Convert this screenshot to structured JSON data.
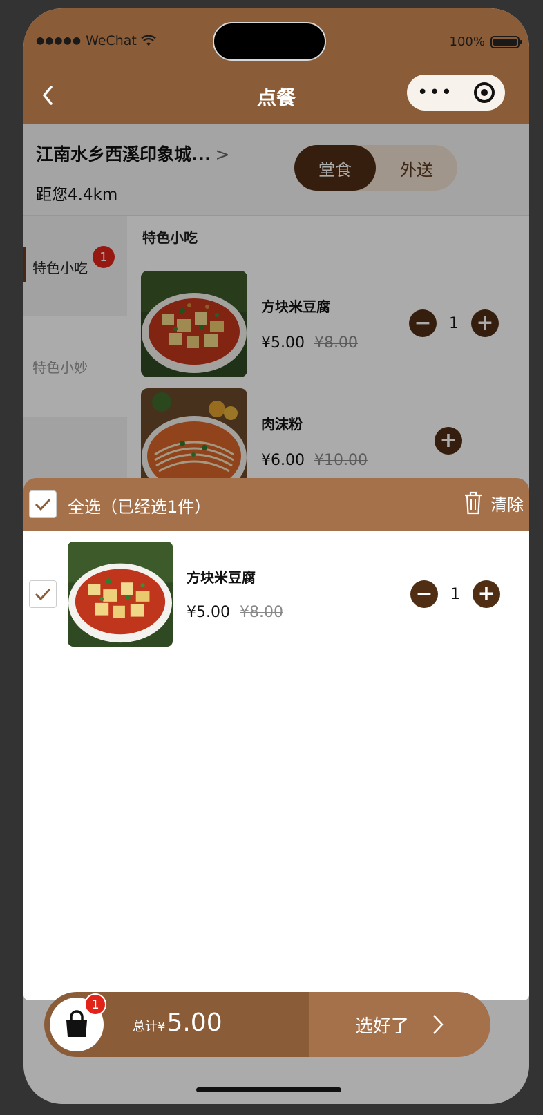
{
  "status": {
    "carrier": "WeChat",
    "battery": "100%"
  },
  "nav": {
    "title": "点餐"
  },
  "store": {
    "name": "江南水乡西溪印象城...",
    "arrow": ">",
    "distance": "距您4.4km",
    "modes": [
      "堂食",
      "外送"
    ],
    "active_mode": "堂食"
  },
  "categories": [
    {
      "label": "特色小吃",
      "badge": "1"
    },
    {
      "label": "特色小妙"
    }
  ],
  "section_title": "特色小吃",
  "dishes": [
    {
      "name": "方块米豆腐",
      "price": "¥5.00",
      "old_price": "¥8.00",
      "qty": "1"
    },
    {
      "name": "肉沫粉",
      "price": "¥6.00",
      "old_price": "¥10.00"
    }
  ],
  "cart": {
    "select_all": "全选（已经选1件）",
    "clear": "清除",
    "items": [
      {
        "name": "方块米豆腐",
        "price": "¥5.00",
        "old_price": "¥8.00",
        "qty": "1"
      }
    ]
  },
  "bottom": {
    "badge": "1",
    "total_label": "总计¥",
    "total": "5.00",
    "checkout": "选好了"
  },
  "colors": {
    "brand_dark": "#4f2e14",
    "brand": "#8a5c38",
    "brand_light": "#a5714b",
    "badge_red": "#e2231a"
  }
}
